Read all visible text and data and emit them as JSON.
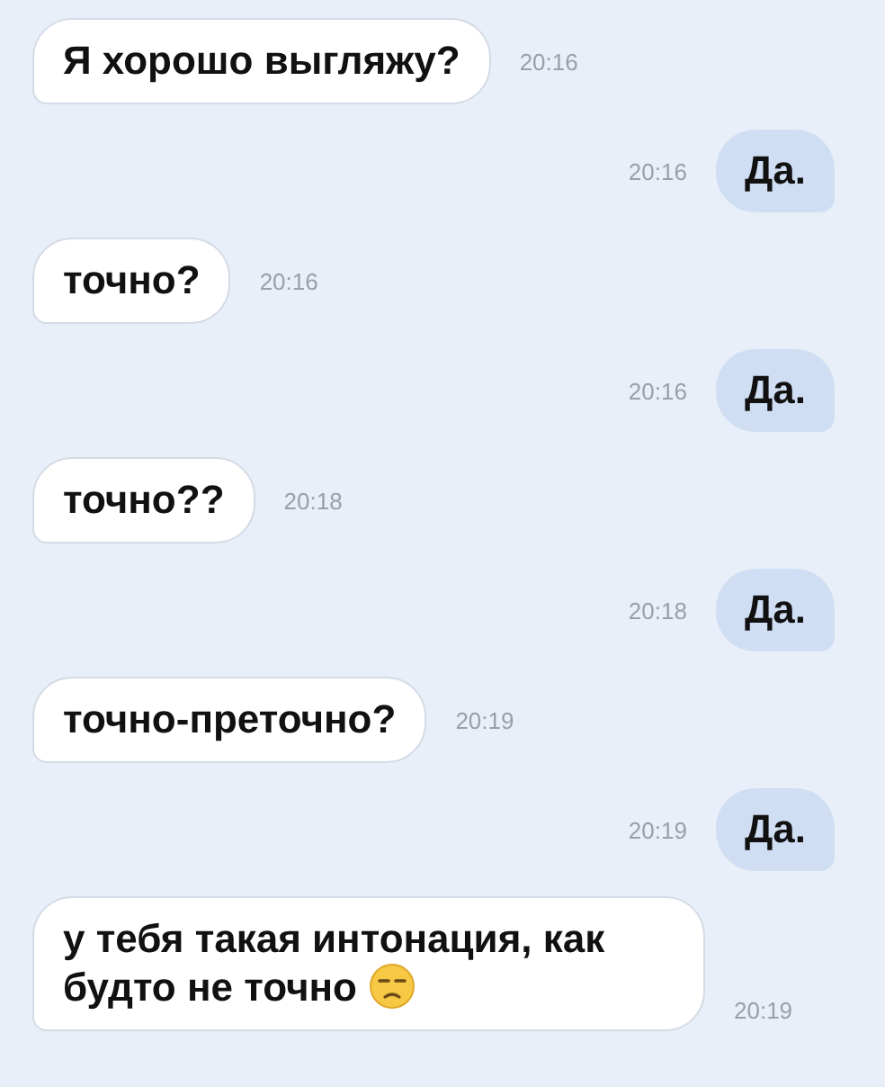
{
  "messages": [
    {
      "kind": "incoming",
      "text": "Я хорошо выгляжу?",
      "time": "20:16",
      "trailing_icon": false
    },
    {
      "kind": "outgoing",
      "text": "Да.",
      "time": "20:16",
      "trailing_icon": false
    },
    {
      "kind": "incoming",
      "text": "точно?",
      "time": "20:16",
      "trailing_icon": false
    },
    {
      "kind": "outgoing",
      "text": "Да.",
      "time": "20:16",
      "trailing_icon": false
    },
    {
      "kind": "incoming",
      "text": "точно??",
      "time": "20:18",
      "trailing_icon": false
    },
    {
      "kind": "outgoing",
      "text": "Да.",
      "time": "20:18",
      "trailing_icon": false
    },
    {
      "kind": "incoming",
      "text": "точно-преточно?",
      "time": "20:19",
      "trailing_icon": false
    },
    {
      "kind": "outgoing",
      "text": "Да.",
      "time": "20:19",
      "trailing_icon": false
    },
    {
      "kind": "incoming",
      "text": "у тебя такая интонация, как будто не точно",
      "time": "20:19",
      "trailing_icon": true
    }
  ]
}
